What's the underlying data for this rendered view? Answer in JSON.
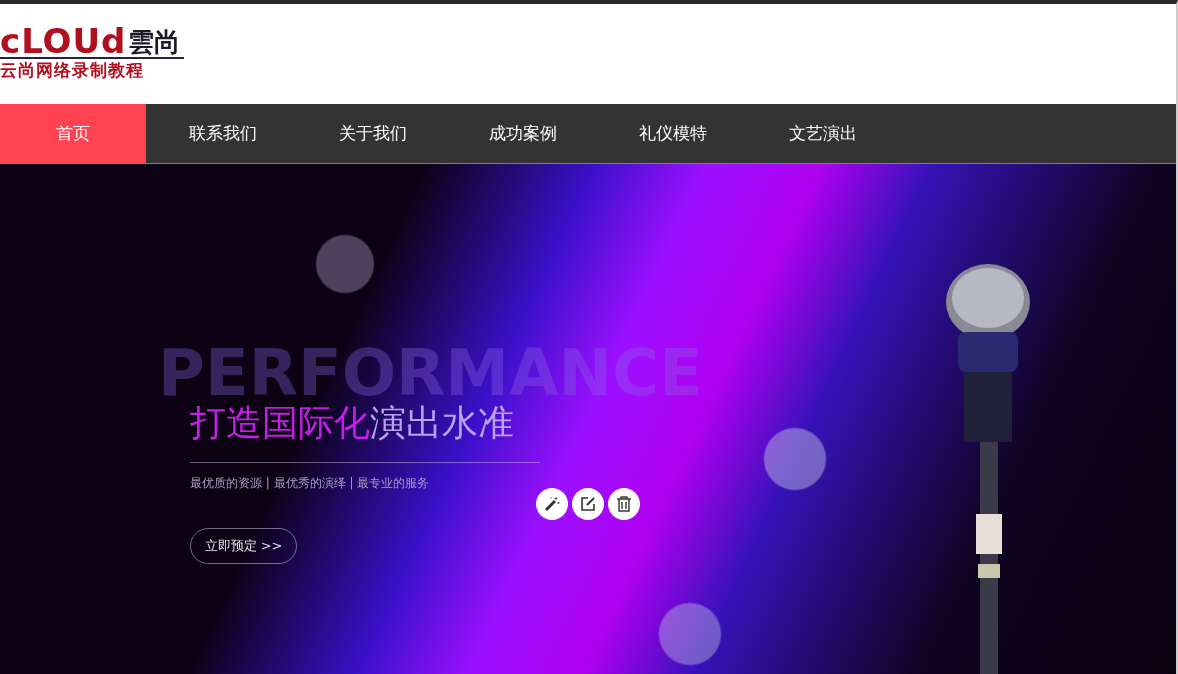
{
  "logo": {
    "wordmark": "cLOUd",
    "mark": "雲尚",
    "tagline": "云尚网络录制教程"
  },
  "nav": [
    {
      "label": "首页",
      "selected": true
    },
    {
      "label": "联系我们",
      "selected": false
    },
    {
      "label": "关于我们",
      "selected": false
    },
    {
      "label": "成功案例",
      "selected": false
    },
    {
      "label": "礼仪模特",
      "selected": false
    },
    {
      "label": "文艺演出",
      "selected": false
    }
  ],
  "hero": {
    "backdrop": "PERFORMANCE",
    "headline": [
      {
        "text": "打造国际化",
        "color": "#c41ee8"
      },
      {
        "text": "演出水准",
        "color": "#b9a2f2"
      }
    ],
    "subtitle": "最优质的资源 | 最优秀的演绎 | 最专业的服务",
    "button": "立即预定 >>",
    "tools": [
      {
        "kind": "magic"
      },
      {
        "kind": "edit"
      },
      {
        "kind": "delete"
      }
    ]
  }
}
